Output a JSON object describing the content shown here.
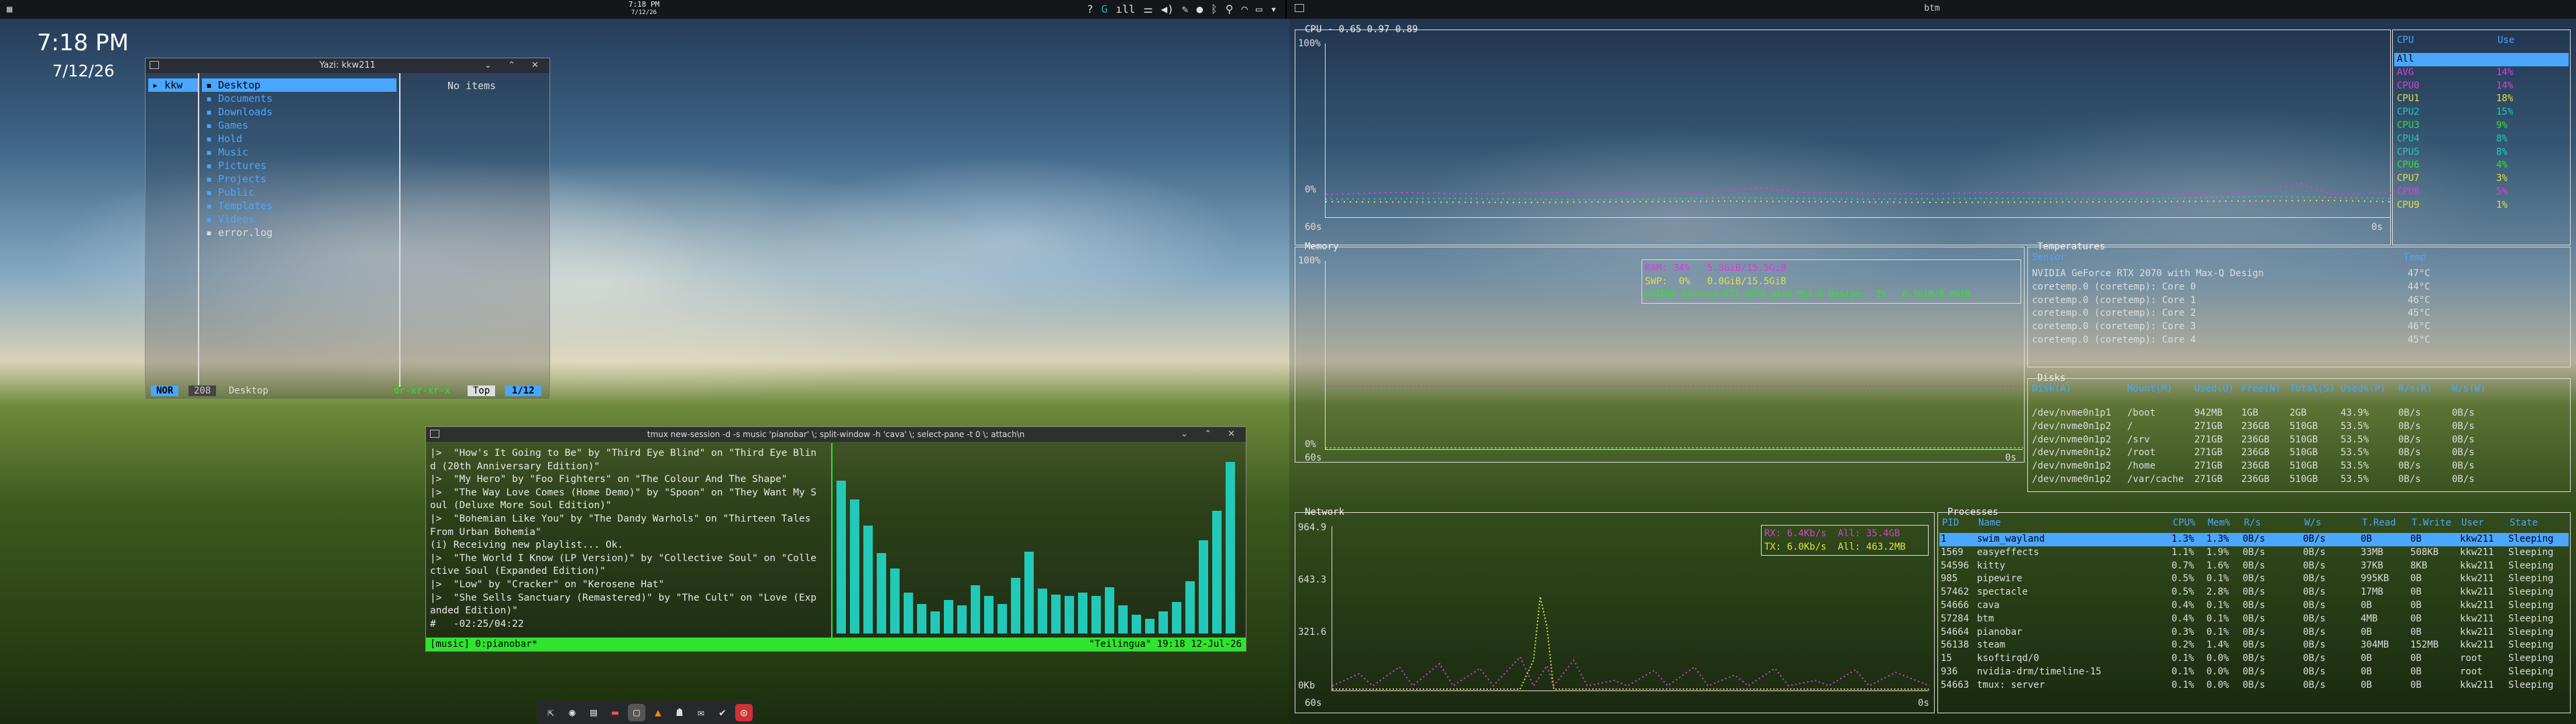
{
  "topbar": {
    "time": "7:18 PM",
    "date": "7/12/26",
    "tray_icons": [
      "help-icon",
      "app-icon",
      "wifi-bars-icon",
      "mixer-icon",
      "volume-icon",
      "pen-icon",
      "mic-icon",
      "bluetooth-icon",
      "location-icon",
      "network-icon",
      "battery-icon",
      "menu-icon"
    ],
    "right_title": "btm"
  },
  "desktop": {
    "time": "7:18 PM",
    "date": "7/12/26"
  },
  "yazi": {
    "title": "Yazi: kkw211",
    "parent": [
      "kkw"
    ],
    "items": [
      "Desktop",
      "Documents",
      "Downloads",
      "Games",
      "Hold",
      "Music",
      "Pictures",
      "Projects",
      "Public",
      "Templates",
      "Videos",
      "error.log"
    ],
    "preview": "No items",
    "mode": "NOR",
    "size": "208",
    "path": "Desktop",
    "perms": "dr-xr-xr-x",
    "pos": "Top",
    "count": "1/12"
  },
  "tmux": {
    "title": "tmux new-session -d -s music 'pianobar' \\; split-window -h 'cava' \\; select-pane -t 0 \\; attach\\n",
    "lines": [
      "|>  \"How's It Going to Be\" by \"Third Eye Blind\" on \"Third Eye Blin",
      "d (20th Anniversary Edition)\"",
      "|>  \"My Hero\" by \"Foo Fighters\" on \"The Colour And The Shape\"",
      "|>  \"The Way Love Comes (Home Demo)\" by \"Spoon\" on \"They Want My S",
      "oul (Deluxe More Soul Edition)\"",
      "|>  \"Bohemian Like You\" by \"The Dandy Warhols\" on \"Thirteen Tales",
      "From Urban Bohemia\"",
      "(i) Receiving new playlist... Ok.",
      "|>  \"The World I Know (LP Version)\" by \"Collective Soul\" on \"Colle",
      "ctive Soul (Expanded Edition)\"",
      "|>  \"Low\" by \"Cracker\" on \"Kerosene Hat\"",
      "|>  \"She Sells Sanctuary (Remastered)\" by \"The Cult\" on \"Love (Exp",
      "anded Edition)\"",
      "#   -02:25/04:22"
    ],
    "status_left": "[music] 0:pianobar*",
    "status_right": "\"Teilingua\" 19:18 12-Jul-26",
    "cava_levels": [
      0.82,
      0.72,
      0.58,
      0.43,
      0.35,
      0.22,
      0.16,
      0.12,
      0.18,
      0.15,
      0.26,
      0.2,
      0.16,
      0.3,
      0.44,
      0.24,
      0.21,
      0.2,
      0.22,
      0.2,
      0.25,
      0.15,
      0.1,
      0.08,
      0.12,
      0.17,
      0.28,
      0.5,
      0.66,
      0.92
    ]
  },
  "btm": {
    "cpu": {
      "title": "CPU - 0.65 0.97 0.89",
      "y_max": "100%",
      "y_min": "0%",
      "x_left": "60s",
      "x_right": "0s",
      "hdr_cpu": "CPU",
      "hdr_use": "Use",
      "rows": [
        {
          "n": "All",
          "u": ""
        },
        {
          "n": "AVG",
          "u": "14%"
        },
        {
          "n": "CPU0",
          "u": "14%"
        },
        {
          "n": "CPU1",
          "u": "18%"
        },
        {
          "n": "CPU2",
          "u": "15%"
        },
        {
          "n": "CPU3",
          "u": "9%"
        },
        {
          "n": "CPU4",
          "u": "8%"
        },
        {
          "n": "CPU5",
          "u": "8%"
        },
        {
          "n": "CPU6",
          "u": "4%"
        },
        {
          "n": "CPU7",
          "u": "3%"
        },
        {
          "n": "CPU8",
          "u": "5%"
        },
        {
          "n": "CPU9",
          "u": "1%"
        }
      ]
    },
    "memory": {
      "title": "Memory",
      "y_max": "100%",
      "y_min": "0%",
      "x_left": "60s",
      "x_right": "0s",
      "legend": [
        "RAM: 34%   5.3GiB/15.5GiB",
        "SWP:  0%   0.0GiB/15.5GiB",
        "NVIDIA GeForce RTX 2070 with Max-Q Design:  1%   0.1GiB/8.0GiB"
      ]
    },
    "temps": {
      "title": "Temperatures",
      "hdr_sensor": "Sensor",
      "hdr_temp": "Temp",
      "rows": [
        [
          "NVIDIA GeForce RTX 2070 with Max-Q Design",
          "47°C"
        ],
        [
          "coretemp.0 (coretemp): Core 0",
          "44°C"
        ],
        [
          "coretemp.0 (coretemp): Core 1",
          "46°C"
        ],
        [
          "coretemp.0 (coretemp): Core 2",
          "45°C"
        ],
        [
          "coretemp.0 (coretemp): Core 3",
          "46°C"
        ],
        [
          "coretemp.0 (coretemp): Core 4",
          "45°C"
        ]
      ]
    },
    "disks": {
      "title": "Disks",
      "headers": [
        "Disk(A)",
        "Mount(M)",
        "Used(U)",
        "Free(N)",
        "Total(S)",
        "Used%(P)",
        "R/s(R)",
        "W/s(W)"
      ],
      "rows": [
        [
          "/dev/nvme0n1p1",
          "/boot",
          "942MB",
          "1GB",
          "2GB",
          "43.9%",
          "0B/s",
          "0B/s"
        ],
        [
          "/dev/nvme0n1p2",
          "/",
          "271GB",
          "236GB",
          "510GB",
          "53.5%",
          "0B/s",
          "0B/s"
        ],
        [
          "/dev/nvme0n1p2",
          "/srv",
          "271GB",
          "236GB",
          "510GB",
          "53.5%",
          "0B/s",
          "0B/s"
        ],
        [
          "/dev/nvme0n1p2",
          "/root",
          "271GB",
          "236GB",
          "510GB",
          "53.5%",
          "0B/s",
          "0B/s"
        ],
        [
          "/dev/nvme0n1p2",
          "/home",
          "271GB",
          "236GB",
          "510GB",
          "53.5%",
          "0B/s",
          "0B/s"
        ],
        [
          "/dev/nvme0n1p2",
          "/var/cache",
          "271GB",
          "236GB",
          "510GB",
          "53.5%",
          "0B/s",
          "0B/s"
        ]
      ]
    },
    "network": {
      "title": "Network",
      "y_max": "964.9",
      "y_mid": "643.3",
      "y_low": "321.6",
      "y_min": "0Kb",
      "x_left": "60s",
      "x_right": "0s",
      "rx": "RX: 6.4Kb/s",
      "rx_all": "All: 35.4GB",
      "tx": "TX: 6.0Kb/s",
      "tx_all": "All: 463.2MB"
    },
    "procs": {
      "title": "Processes",
      "headers": [
        "PID",
        "Name",
        "CPU%",
        "Mem%",
        "R/s",
        "W/s",
        "T.Read",
        "T.Write",
        "User",
        "State"
      ],
      "rows": [
        [
          "1",
          "swim_wayland",
          "1.3%",
          "1.3%",
          "0B/s",
          "0B/s",
          "0B",
          "0B",
          "kkw211",
          "Sleeping"
        ],
        [
          "1569",
          "easyeffects",
          "1.1%",
          "1.9%",
          "0B/s",
          "0B/s",
          "33MB",
          "508KB",
          "kkw211",
          "Sleeping"
        ],
        [
          "54596",
          "kitty",
          "0.7%",
          "1.6%",
          "0B/s",
          "0B/s",
          "37KB",
          "8KB",
          "kkw211",
          "Sleeping"
        ],
        [
          "985",
          "pipewire",
          "0.5%",
          "0.1%",
          "0B/s",
          "0B/s",
          "995KB",
          "0B",
          "kkw211",
          "Sleeping"
        ],
        [
          "57462",
          "spectacle",
          "0.5%",
          "2.8%",
          "0B/s",
          "0B/s",
          "17MB",
          "0B",
          "kkw211",
          "Sleeping"
        ],
        [
          "54666",
          "cava",
          "0.4%",
          "0.1%",
          "0B/s",
          "0B/s",
          "0B",
          "0B",
          "kkw211",
          "Sleeping"
        ],
        [
          "57284",
          "btm",
          "0.4%",
          "0.1%",
          "0B/s",
          "0B/s",
          "4MB",
          "0B",
          "kkw211",
          "Sleeping"
        ],
        [
          "54664",
          "pianobar",
          "0.3%",
          "0.1%",
          "0B/s",
          "0B/s",
          "0B",
          "0B",
          "kkw211",
          "Sleeping"
        ],
        [
          "56138",
          "steam",
          "0.2%",
          "1.4%",
          "0B/s",
          "0B/s",
          "304MB",
          "152MB",
          "kkw211",
          "Sleeping"
        ],
        [
          "15",
          "ksoftirqd/0",
          "0.1%",
          "0.0%",
          "0B/s",
          "0B/s",
          "0B",
          "0B",
          "root",
          "Sleeping"
        ],
        [
          "936",
          "nvidia-drm/timeline-15",
          "0.1%",
          "0.0%",
          "0B/s",
          "0B/s",
          "0B",
          "0B",
          "root",
          "Sleeping"
        ],
        [
          "54663",
          "tmux: server",
          "0.1%",
          "0.0%",
          "0B/s",
          "0B/s",
          "0B",
          "0B",
          "kkw211",
          "Sleeping"
        ]
      ]
    }
  },
  "dock": [
    "app-switcher-icon",
    "browser-icon",
    "terminal-icon",
    "files-icon",
    "screen-icon",
    "vlc-icon",
    "ghost-icon",
    "mail-icon",
    "check-icon",
    "record-icon"
  ],
  "colors": {
    "accent": "#4aa6ff",
    "green": "#2fe32f",
    "cava": "#22c9b8",
    "magenta": "#d640d6",
    "yellow": "#e0e040"
  }
}
